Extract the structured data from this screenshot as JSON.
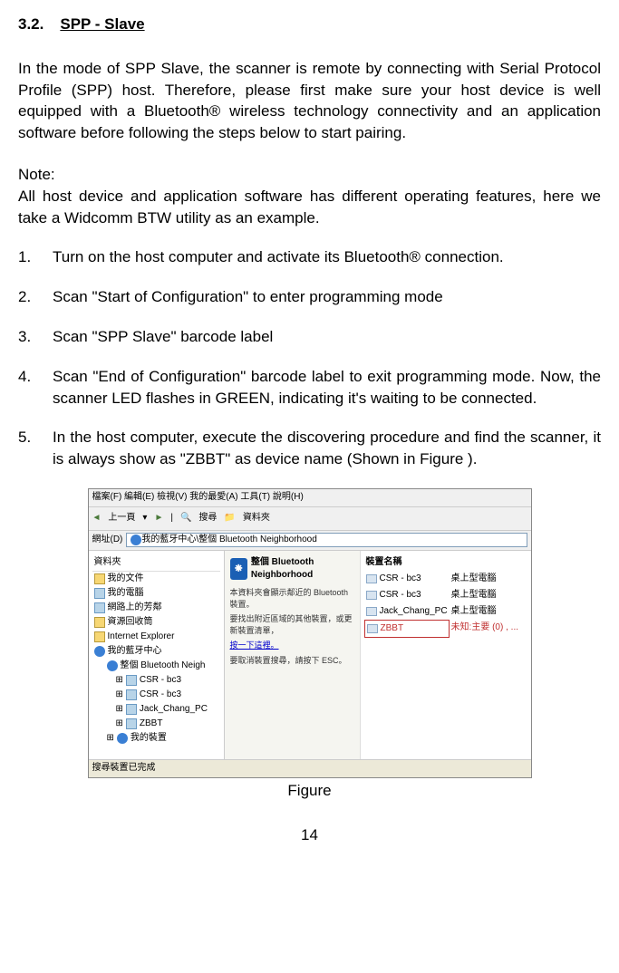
{
  "header": {
    "number": "3.2.",
    "title": "SPP - Slave"
  },
  "intro": "In the mode of SPP Slave, the scanner is remote by connecting with Serial Protocol Profile (SPP) host.   Therefore, please first make sure your host device is well equipped with a Bluetooth® wireless technology connectivity and an application software before following the steps below to start pairing.",
  "note_label": "Note:",
  "note_text": "All host device and application software has different operating features, here we take a Widcomm BTW utility as an example.",
  "steps": [
    {
      "num": "1.",
      "text": "Turn on the host computer and activate its Bluetooth® connection."
    },
    {
      "num": "2.",
      "text": "Scan \"Start of Configuration\" to enter programming mode"
    },
    {
      "num": "3.",
      "text": "Scan \"SPP Slave\" barcode label"
    },
    {
      "num": "4.",
      "text": "Scan \"End of Configuration\" barcode label to exit programming mode. Now, the scanner LED flashes in GREEN, indicating it's waiting to be connected."
    },
    {
      "num": "5.",
      "text": "In the host computer, execute the discovering procedure and find the scanner, it is always show as \"ZBBT\" as device name (Shown in Figure )."
    }
  ],
  "screenshot": {
    "menubar": "檔案(F)  編輯(E)  檢視(V)  我的最愛(A)  工具(T)  說明(H)",
    "toolbar": {
      "back": "上一頁",
      "search": "搜尋",
      "folders": "資料夾"
    },
    "addressbar": {
      "label": "網址(D)",
      "value": "我的藍牙中心\\整個 Bluetooth Neighborhood"
    },
    "sidebar_header": "資料夾",
    "tree": [
      {
        "label": "我的文件",
        "icon": "folder",
        "indent": 0
      },
      {
        "label": "我的電腦",
        "icon": "computer",
        "indent": 0
      },
      {
        "label": "網路上的芳鄰",
        "icon": "computer",
        "indent": 0
      },
      {
        "label": "資源回收筒",
        "icon": "folder",
        "indent": 0
      },
      {
        "label": "Internet Explorer",
        "icon": "folder",
        "indent": 0
      },
      {
        "label": "我的藍牙中心",
        "icon": "bt",
        "indent": 0
      },
      {
        "label": "整個 Bluetooth Neigh",
        "icon": "bt",
        "indent": 1
      },
      {
        "label": "CSR - bc3",
        "icon": "computer",
        "indent": 2
      },
      {
        "label": "CSR - bc3",
        "icon": "computer",
        "indent": 2
      },
      {
        "label": "Jack_Chang_PC",
        "icon": "computer",
        "indent": 2
      },
      {
        "label": "ZBBT",
        "icon": "computer",
        "indent": 2
      },
      {
        "label": "我的裝置",
        "icon": "bt",
        "indent": 1
      }
    ],
    "info": {
      "title": "整個 Bluetooth Neighborhood",
      "text1": "本資料夾會顯示鄰近的 Bluetooth 裝置。",
      "text2": "要找出附近區域的其他裝置，或更新裝置清單，",
      "link": "按一下這裡。",
      "text3": "要取消裝置搜尋，請按下 ESC。"
    },
    "devices_col1": [
      {
        "label": "裝置名稱",
        "bold": true
      },
      {
        "label": "CSR - bc3"
      },
      {
        "label": "CSR - bc3"
      },
      {
        "label": "Jack_Chang_PC"
      },
      {
        "label": "ZBBT",
        "highlight": true
      }
    ],
    "devices_col2": [
      {
        "label": "桌上型電腦"
      },
      {
        "label": "桌上型電腦"
      },
      {
        "label": "桌上型電腦"
      },
      {
        "label": "未知:主要 (0) , ..."
      }
    ],
    "statusbar": "搜尋裝置已完成"
  },
  "figure_caption": "Figure",
  "page_number": "14"
}
